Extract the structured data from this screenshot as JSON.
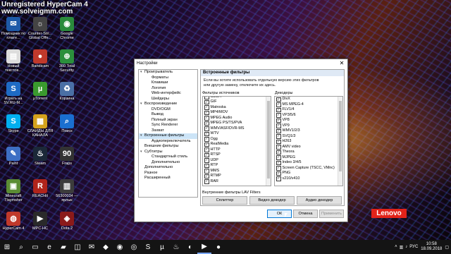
{
  "watermark": {
    "line1": "Unregistered HyperCam 4",
    "line2": "www.solveigmm.com"
  },
  "desktop_icons": [
    {
      "label": "Помощник по плате...",
      "color": "#1e5aa8",
      "glyph": "✉"
    },
    {
      "label": "Counter-Stri... Global Offe...",
      "color": "#444444",
      "glyph": "☼"
    },
    {
      "label": "Google Chrome",
      "color": "#2a8b3c",
      "glyph": "◉"
    },
    {
      "label": "Новый текстов...",
      "color": "#dcdcdc",
      "glyph": "▤"
    },
    {
      "label": "Bandicam",
      "color": "#c0392b",
      "glyph": "●"
    },
    {
      "label": "360 Total Security",
      "color": "#2b8f3c",
      "glyph": "⊕"
    },
    {
      "label": "Играть на SV.RU-М...",
      "color": "#1e6bc4",
      "glyph": "S"
    },
    {
      "label": "µTorrent",
      "color": "#3a9a2e",
      "glyph": "µ"
    },
    {
      "label": "Корзина",
      "color": "#4a6fa5",
      "glyph": "♻"
    },
    {
      "label": "Skype",
      "color": "#00aff0",
      "glyph": "S"
    },
    {
      "label": "СЛАЙДЫ ДЛЯ КАНАЛА",
      "color": "#d4a21c",
      "glyph": "▦"
    },
    {
      "label": "Поиск",
      "color": "#1a6fd0",
      "glyph": "⌕"
    },
    {
      "label": "Paint",
      "color": "#3d6fc4",
      "glyph": "✎"
    },
    {
      "label": "Steam",
      "color": "#1b2838",
      "glyph": "♨"
    },
    {
      "label": "Fraps",
      "color": "#333333",
      "glyph": "90"
    },
    {
      "label": "Minecraft Tlaymsher",
      "color": "#5b8c34",
      "glyph": "▣"
    },
    {
      "label": "REACHit",
      "color": "#b0241b",
      "glyph": "R"
    },
    {
      "label": "56300034 — ярлык",
      "color": "#3c3c3c",
      "glyph": "▥"
    },
    {
      "label": "HyperCam 4",
      "color": "#c0392b",
      "glyph": "◍"
    },
    {
      "label": "MPC-HC",
      "color": "#2a2a2a",
      "glyph": "▶"
    },
    {
      "label": "Dota 2",
      "color": "#8b1a1a",
      "glyph": "◈"
    }
  ],
  "lenovo": "Lenovo",
  "dialog": {
    "title": "Настройки",
    "tree": [
      {
        "label": "Проигрыватель",
        "level": 0,
        "toggle": "▾"
      },
      {
        "label": "Форматы",
        "level": 1
      },
      {
        "label": "Клавиши",
        "level": 1
      },
      {
        "label": "Логотип",
        "level": 1
      },
      {
        "label": "Web-интерфейс",
        "level": 1
      },
      {
        "label": "Шейдеры",
        "level": 1
      },
      {
        "label": "Воспроизведение",
        "level": 0,
        "toggle": "▾"
      },
      {
        "label": "DVD/OGM",
        "level": 1
      },
      {
        "label": "Вывод",
        "level": 1
      },
      {
        "label": "Полный экран",
        "level": 1
      },
      {
        "label": "Sync Renderer",
        "level": 1
      },
      {
        "label": "Захват",
        "level": 1
      },
      {
        "label": "Встроенные фильтры",
        "level": 0,
        "toggle": "▾",
        "selected": true
      },
      {
        "label": "Аудиопереключатель",
        "level": 1
      },
      {
        "label": "Внешние фильтры",
        "level": 0
      },
      {
        "label": "Субтитры",
        "level": 0,
        "toggle": "▾"
      },
      {
        "label": "Стандартный стиль",
        "level": 1
      },
      {
        "label": "Дополнительно",
        "level": 1
      },
      {
        "label": "Дополнительно",
        "level": 0
      },
      {
        "label": "Разное",
        "level": 0
      },
      {
        "label": "Расширенный",
        "level": 0
      }
    ],
    "panel_title": "Встроенные фильтры",
    "description": "Если вы хотите использовать отдельную версию этих фильтров или другую замену, отключите их здесь.",
    "source_label": "Фильтры источников",
    "decoder_label": "Декодеры",
    "sources": [
      "AVI",
      "CDDA",
      "GIF",
      "Matroska",
      "MP4/MOV",
      "MPEG Audio",
      "MPEG PS/TS/PVA",
      "WMV/ASF/DVR-MS",
      "WTV",
      "Ogg",
      "RealMedia",
      "HTTP",
      "RTSP",
      "UDP",
      "RTP",
      "MMS",
      "RTMP",
      "RAR"
    ],
    "decoders": [
      "DivX",
      "MS MPEG-4",
      "FLV1/4",
      "VP3/5/6",
      "VP8",
      "VP9",
      "WMV1/2/3",
      "SVQ1/3",
      "H263",
      "AMV video",
      "Theora",
      "MJPEG",
      "Indeo 3/4/5",
      "Screen Capture (TSCC, VMnc)",
      "PNG",
      "v210/v410"
    ],
    "internal_label": "Внутренние фильтры LAV Filters",
    "btn_splitter": "Сплиттер",
    "btn_video": "Видео декодер",
    "btn_audio": "Аудио декодер",
    "btn_ok": "ОК",
    "btn_cancel": "Отмена",
    "btn_apply": "Применить"
  },
  "taskbar": {
    "lang": "РУС",
    "time": "10:58",
    "date": "18.09.2018"
  }
}
